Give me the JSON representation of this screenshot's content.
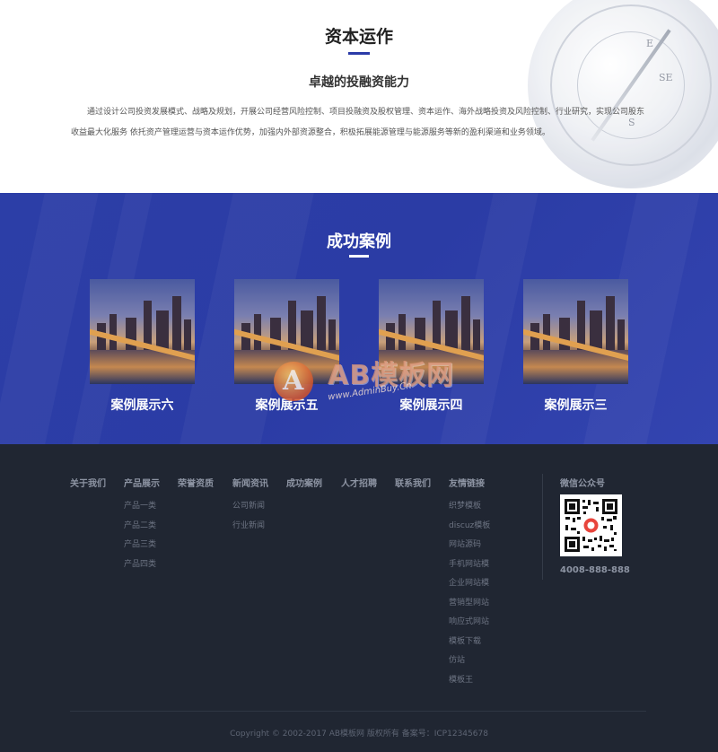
{
  "capital": {
    "title": "资本运作",
    "subtitle": "卓越的投融资能力",
    "description": "通过设计公司投资发展模式、战略及规划，开展公司经营风险控制、项目投融资及股权管理、资本运作、海外战略投资及风险控制、行业研究，实现公司股东收益最大化服务 依托资产管理运营与资本运作优势，加强内外部资源整合，积极拓展能源管理与能源服务等新的盈利渠道和业务领域。",
    "compass_marks": [
      "E",
      "SE",
      "S"
    ]
  },
  "cases": {
    "title": "成功案例",
    "items": [
      {
        "label": "案例展示六"
      },
      {
        "label": "案例展示五"
      },
      {
        "label": "案例展示四"
      },
      {
        "label": "案例展示三"
      }
    ]
  },
  "footer": {
    "columns": [
      {
        "head": "关于我们",
        "items": []
      },
      {
        "head": "产品展示",
        "items": [
          "产品一类",
          "产品二类",
          "产品三类",
          "产品四类"
        ]
      },
      {
        "head": "荣誉资质",
        "items": []
      },
      {
        "head": "新闻资讯",
        "items": [
          "公司新闻",
          "行业新闻"
        ]
      },
      {
        "head": "成功案例",
        "items": []
      },
      {
        "head": "人才招聘",
        "items": []
      },
      {
        "head": "联系我们",
        "items": []
      },
      {
        "head": "友情链接",
        "items": [
          "织梦模板",
          "discuz模板",
          "网站源码",
          "手机网站模",
          "企业网站模",
          "营销型网站",
          "响应式网站",
          "模板下载",
          "仿站",
          "模板王"
        ]
      }
    ],
    "wechat_title": "微信公众号",
    "phone": "4008-888-888",
    "copyright": "Copyright © 2002-2017 AB模板网 版权所有  备案号：ICP12345678"
  },
  "watermark": {
    "logo_letter": "A",
    "brand": "AB模板网",
    "url": "www.AdminBuy.Cn"
  },
  "colors": {
    "accent": "#2b3ba8",
    "cases_bg": "#2c3ea7",
    "footer_bg": "#202632"
  }
}
